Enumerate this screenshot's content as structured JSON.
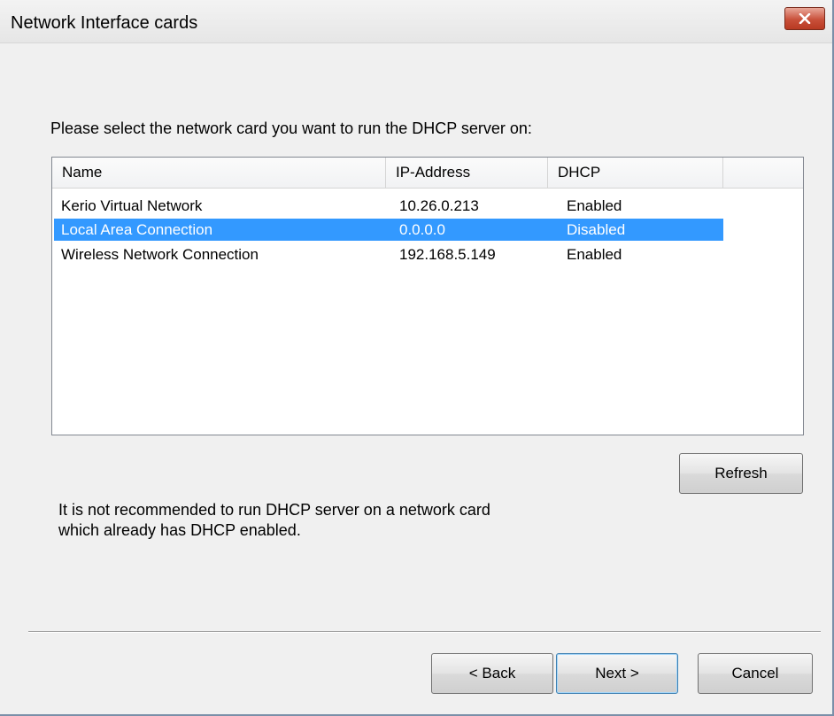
{
  "window": {
    "title": "Network Interface cards",
    "close_icon": "close-x-icon",
    "close_color": "#c9503a"
  },
  "prompt": "Please select the network card you want to run the DHCP server on:",
  "list": {
    "columns": [
      "Name",
      "IP-Address",
      "DHCP"
    ],
    "rows": [
      {
        "name": "Kerio Virtual Network",
        "ip": "10.26.0.213",
        "dhcp": "Enabled",
        "selected": false
      },
      {
        "name": "Local Area Connection",
        "ip": "0.0.0.0",
        "dhcp": "Disabled",
        "selected": true
      },
      {
        "name": "Wireless Network Connection",
        "ip": "192.168.5.149",
        "dhcp": "Enabled",
        "selected": false
      }
    ],
    "selection_color": "#3399ff"
  },
  "refresh_label": "Refresh",
  "note": {
    "line1": "It is not recommended to run DHCP server on a network card",
    "line2": "which already has DHCP enabled."
  },
  "buttons": {
    "back": "< Back",
    "next": "Next >",
    "cancel": "Cancel"
  }
}
